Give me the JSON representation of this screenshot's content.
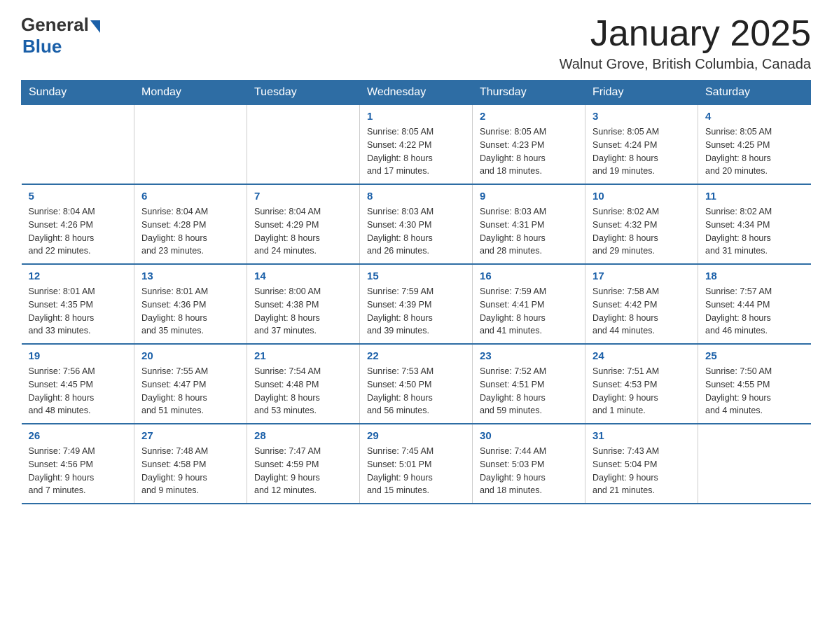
{
  "logo": {
    "general": "General",
    "blue": "Blue"
  },
  "title": "January 2025",
  "subtitle": "Walnut Grove, British Columbia, Canada",
  "days_of_week": [
    "Sunday",
    "Monday",
    "Tuesday",
    "Wednesday",
    "Thursday",
    "Friday",
    "Saturday"
  ],
  "weeks": [
    [
      {
        "day": "",
        "info": ""
      },
      {
        "day": "",
        "info": ""
      },
      {
        "day": "",
        "info": ""
      },
      {
        "day": "1",
        "info": "Sunrise: 8:05 AM\nSunset: 4:22 PM\nDaylight: 8 hours\nand 17 minutes."
      },
      {
        "day": "2",
        "info": "Sunrise: 8:05 AM\nSunset: 4:23 PM\nDaylight: 8 hours\nand 18 minutes."
      },
      {
        "day": "3",
        "info": "Sunrise: 8:05 AM\nSunset: 4:24 PM\nDaylight: 8 hours\nand 19 minutes."
      },
      {
        "day": "4",
        "info": "Sunrise: 8:05 AM\nSunset: 4:25 PM\nDaylight: 8 hours\nand 20 minutes."
      }
    ],
    [
      {
        "day": "5",
        "info": "Sunrise: 8:04 AM\nSunset: 4:26 PM\nDaylight: 8 hours\nand 22 minutes."
      },
      {
        "day": "6",
        "info": "Sunrise: 8:04 AM\nSunset: 4:28 PM\nDaylight: 8 hours\nand 23 minutes."
      },
      {
        "day": "7",
        "info": "Sunrise: 8:04 AM\nSunset: 4:29 PM\nDaylight: 8 hours\nand 24 minutes."
      },
      {
        "day": "8",
        "info": "Sunrise: 8:03 AM\nSunset: 4:30 PM\nDaylight: 8 hours\nand 26 minutes."
      },
      {
        "day": "9",
        "info": "Sunrise: 8:03 AM\nSunset: 4:31 PM\nDaylight: 8 hours\nand 28 minutes."
      },
      {
        "day": "10",
        "info": "Sunrise: 8:02 AM\nSunset: 4:32 PM\nDaylight: 8 hours\nand 29 minutes."
      },
      {
        "day": "11",
        "info": "Sunrise: 8:02 AM\nSunset: 4:34 PM\nDaylight: 8 hours\nand 31 minutes."
      }
    ],
    [
      {
        "day": "12",
        "info": "Sunrise: 8:01 AM\nSunset: 4:35 PM\nDaylight: 8 hours\nand 33 minutes."
      },
      {
        "day": "13",
        "info": "Sunrise: 8:01 AM\nSunset: 4:36 PM\nDaylight: 8 hours\nand 35 minutes."
      },
      {
        "day": "14",
        "info": "Sunrise: 8:00 AM\nSunset: 4:38 PM\nDaylight: 8 hours\nand 37 minutes."
      },
      {
        "day": "15",
        "info": "Sunrise: 7:59 AM\nSunset: 4:39 PM\nDaylight: 8 hours\nand 39 minutes."
      },
      {
        "day": "16",
        "info": "Sunrise: 7:59 AM\nSunset: 4:41 PM\nDaylight: 8 hours\nand 41 minutes."
      },
      {
        "day": "17",
        "info": "Sunrise: 7:58 AM\nSunset: 4:42 PM\nDaylight: 8 hours\nand 44 minutes."
      },
      {
        "day": "18",
        "info": "Sunrise: 7:57 AM\nSunset: 4:44 PM\nDaylight: 8 hours\nand 46 minutes."
      }
    ],
    [
      {
        "day": "19",
        "info": "Sunrise: 7:56 AM\nSunset: 4:45 PM\nDaylight: 8 hours\nand 48 minutes."
      },
      {
        "day": "20",
        "info": "Sunrise: 7:55 AM\nSunset: 4:47 PM\nDaylight: 8 hours\nand 51 minutes."
      },
      {
        "day": "21",
        "info": "Sunrise: 7:54 AM\nSunset: 4:48 PM\nDaylight: 8 hours\nand 53 minutes."
      },
      {
        "day": "22",
        "info": "Sunrise: 7:53 AM\nSunset: 4:50 PM\nDaylight: 8 hours\nand 56 minutes."
      },
      {
        "day": "23",
        "info": "Sunrise: 7:52 AM\nSunset: 4:51 PM\nDaylight: 8 hours\nand 59 minutes."
      },
      {
        "day": "24",
        "info": "Sunrise: 7:51 AM\nSunset: 4:53 PM\nDaylight: 9 hours\nand 1 minute."
      },
      {
        "day": "25",
        "info": "Sunrise: 7:50 AM\nSunset: 4:55 PM\nDaylight: 9 hours\nand 4 minutes."
      }
    ],
    [
      {
        "day": "26",
        "info": "Sunrise: 7:49 AM\nSunset: 4:56 PM\nDaylight: 9 hours\nand 7 minutes."
      },
      {
        "day": "27",
        "info": "Sunrise: 7:48 AM\nSunset: 4:58 PM\nDaylight: 9 hours\nand 9 minutes."
      },
      {
        "day": "28",
        "info": "Sunrise: 7:47 AM\nSunset: 4:59 PM\nDaylight: 9 hours\nand 12 minutes."
      },
      {
        "day": "29",
        "info": "Sunrise: 7:45 AM\nSunset: 5:01 PM\nDaylight: 9 hours\nand 15 minutes."
      },
      {
        "day": "30",
        "info": "Sunrise: 7:44 AM\nSunset: 5:03 PM\nDaylight: 9 hours\nand 18 minutes."
      },
      {
        "day": "31",
        "info": "Sunrise: 7:43 AM\nSunset: 5:04 PM\nDaylight: 9 hours\nand 21 minutes."
      },
      {
        "day": "",
        "info": ""
      }
    ]
  ]
}
